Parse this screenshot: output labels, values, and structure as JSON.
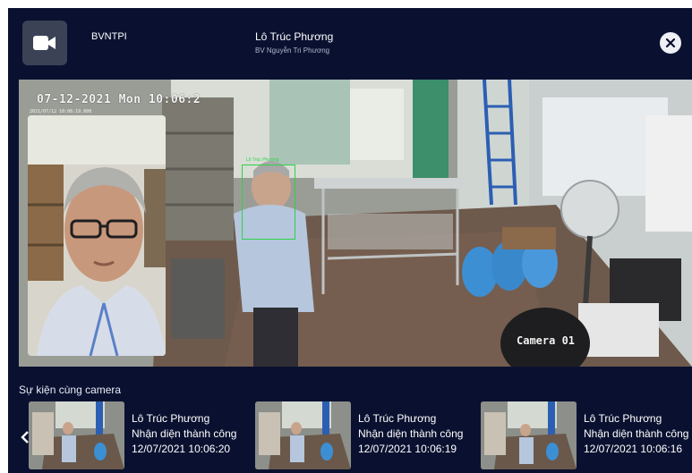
{
  "header": {
    "device_name": "BVNTPI",
    "person_name": "Lô Trúc Phương",
    "organization": "BV Nguyễn Tri Phương"
  },
  "camera": {
    "osd_datetime": "07-12-2021 Mon 10:06:2",
    "osd_small": "2021/07/12 10:06:19.000",
    "camera_label": "Camera 01",
    "face_label": "Lô Trúc Phương"
  },
  "events": {
    "title": "Sự kiện cùng camera",
    "items": [
      {
        "name": "Lô Trúc Phương",
        "status": "Nhận diện thành công",
        "time": "12/07/2021 10:06:20"
      },
      {
        "name": "Lô Trúc Phương",
        "status": "Nhận diện thành công",
        "time": "12/07/2021 10:06:19"
      },
      {
        "name": "Lô Trúc Phương",
        "status": "Nhận diện thành công",
        "time": "12/07/2021 10:06:16"
      }
    ]
  },
  "icons": {
    "camera": "video-camera-icon",
    "close": "close-icon",
    "prev": "chevron-left-icon"
  },
  "colors": {
    "background": "#0a1130",
    "face_box": "#2bd34a"
  }
}
